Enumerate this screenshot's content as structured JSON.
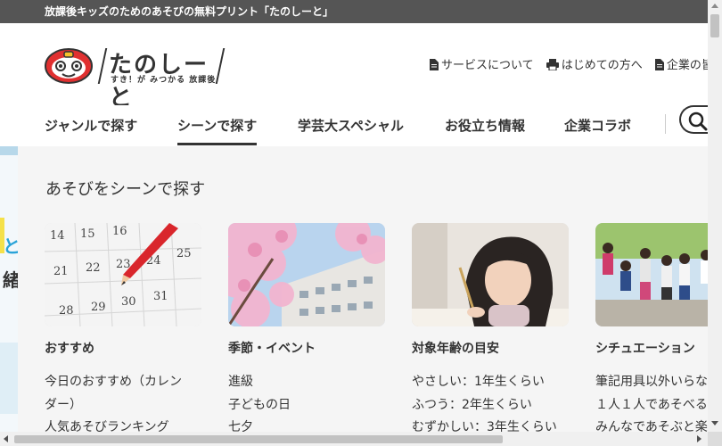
{
  "topbar": {
    "text": "放課後キッズのためのあそびの無料プリント「たのしーと」"
  },
  "logo": {
    "text": "たのしーと",
    "sub": "すき！が みつかる 放課後"
  },
  "header_nav": [
    {
      "label": "サービスについて",
      "icon": "document-icon"
    },
    {
      "label": "はじめての方へ",
      "icon": "printer-icon"
    },
    {
      "label": "企業の皆",
      "icon": "document-icon"
    }
  ],
  "global_nav": {
    "items": [
      {
        "label": "ジャンルで探す",
        "active": false
      },
      {
        "label": "シーンで探す",
        "active": true
      },
      {
        "label": "学芸大スペシャル",
        "active": false
      },
      {
        "label": "お役立ち情報",
        "active": false
      },
      {
        "label": "企業コラボ",
        "active": false
      }
    ],
    "search_icon": "search-icon"
  },
  "left_strip": {
    "chars": [
      "と",
      "緒"
    ]
  },
  "panel": {
    "title": "あそびをシーンで探す",
    "columns": [
      {
        "title": "おすすめ",
        "image": "calendar-with-pencil",
        "calendar_numbers": [
          "14",
          "15",
          "16",
          "21",
          "22",
          "23",
          "24",
          "25",
          "28",
          "29",
          "30",
          "31"
        ],
        "links": [
          "今日のおすすめ（カレン",
          "ダー）",
          "人気あそびランキング"
        ]
      },
      {
        "title": "季節・イベント",
        "image": "cherry-blossom-school",
        "links": [
          "進級",
          "子どもの日",
          "七夕"
        ]
      },
      {
        "title": "対象年齢の目安",
        "image": "girl-drawing",
        "links": [
          "やさしい：1年生くらい",
          "ふつう：2年生くらい",
          "むずかしい：3年生くらい"
        ]
      },
      {
        "title": "シチュエーション",
        "image": "kids-playing-outside",
        "links": [
          "筆記用具以外いらな",
          "１人１人であそべる",
          "みんなであそぶと楽"
        ]
      }
    ]
  },
  "colors": {
    "topbar_bg": "#555555",
    "panel_bg": "#f5f5f5",
    "logo_red": "#e03030",
    "text": "#333333"
  }
}
